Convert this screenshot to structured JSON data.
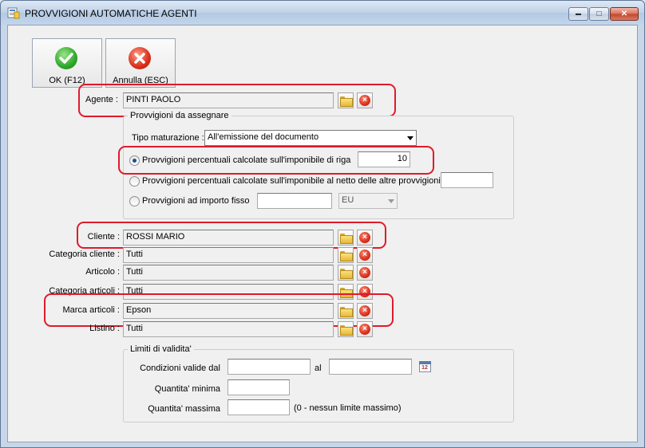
{
  "window": {
    "title": "PROVVIGIONI AUTOMATICHE AGENTI",
    "min_glyph": "▬",
    "max_glyph": "□",
    "close_glyph": "✕"
  },
  "toolbar": {
    "ok_label": "OK (F12)",
    "cancel_label": "Annulla (ESC)"
  },
  "agent": {
    "label": "Agente :",
    "value": "PINTI PAOLO"
  },
  "commission": {
    "group_title": "Provvigioni da assegnare",
    "maturation_label": "Tipo maturazione :",
    "maturation_value": "All'emissione del documento",
    "options": [
      {
        "label": "Provvigioni percentuali calcolate sull'imponibile di riga",
        "selected": true,
        "value": "10"
      },
      {
        "label": "Provvigioni percentuali calcolate sull'imponibile al netto delle altre provvigioni",
        "selected": false,
        "value": ""
      },
      {
        "label": "Provvigioni ad importo fisso",
        "selected": false,
        "value": "",
        "currency": "EU"
      }
    ]
  },
  "filters": [
    {
      "label": "Cliente :",
      "value": "ROSSI MARIO"
    },
    {
      "label": "Categoria cliente :",
      "value": "Tutti"
    },
    {
      "label": "Articolo :",
      "value": "Tutti"
    },
    {
      "label": "Categoria articoli :",
      "value": "Tutti"
    },
    {
      "label": "Marca articoli :",
      "value": "Epson"
    },
    {
      "label": "Listino :",
      "value": "Tutti"
    }
  ],
  "validity": {
    "group_title": "Limiti di validita'",
    "valid_from_label": "Condizioni valide dal",
    "valid_to_label": "al",
    "min_qty_label": "Quantita' minima",
    "max_qty_label": "Quantita' massima",
    "max_qty_hint": "(0 - nessun limite massimo)",
    "calendar_day": "12"
  },
  "icons": {
    "ok": "check-icon",
    "cancel": "cancel-x-icon",
    "browse": "folder-icon",
    "clear": "clear-x-icon",
    "calendar": "calendar-icon"
  },
  "colors": {
    "ok_green": "#2ea82a",
    "cancel_red": "#d9301b",
    "highlight_red": "#e01a2a"
  }
}
